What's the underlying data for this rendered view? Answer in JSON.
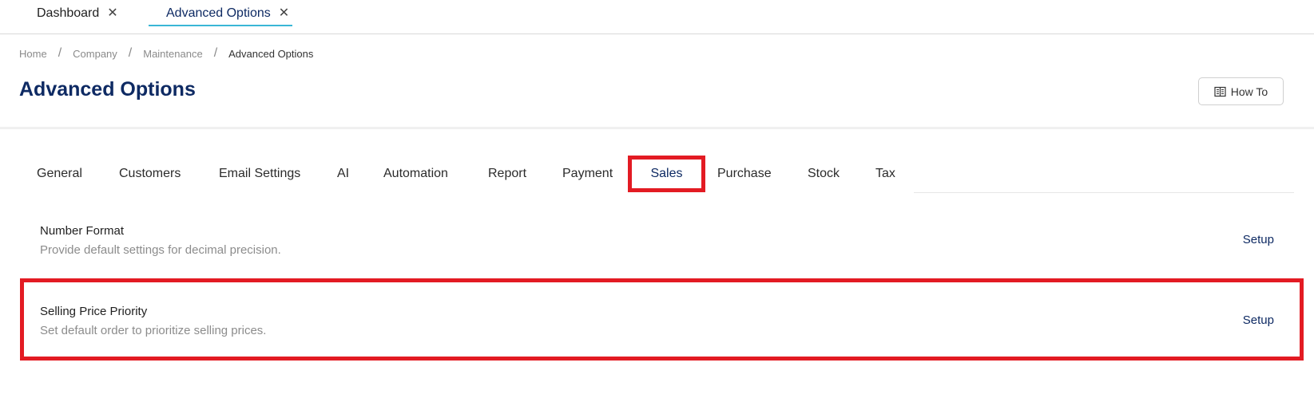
{
  "top_tabs": [
    {
      "label": "Dashboard"
    },
    {
      "label": "Advanced Options"
    }
  ],
  "breadcrumb": [
    "Home",
    "Company",
    "Maintenance",
    "Advanced Options"
  ],
  "page": {
    "title": "Advanced Options",
    "how_to_label": "How To"
  },
  "section_tabs": [
    {
      "label": "General"
    },
    {
      "label": "Customers"
    },
    {
      "label": "Email Settings"
    },
    {
      "label": "AI"
    },
    {
      "label": "Automation"
    },
    {
      "label": "Report"
    },
    {
      "label": "Payment"
    },
    {
      "label": "Sales",
      "active": true
    },
    {
      "label": "Purchase"
    },
    {
      "label": "Stock"
    },
    {
      "label": "Tax"
    }
  ],
  "settings": [
    {
      "title": "Number Format",
      "description": "Provide default settings for decimal precision.",
      "action": "Setup"
    },
    {
      "title": "Selling Price Priority",
      "description": "Set default order to prioritize selling prices.",
      "action": "Setup"
    }
  ],
  "colors": {
    "brand_navy": "#0e2a63",
    "active_underline": "#3ab6d6",
    "highlight_red": "#e31b23"
  }
}
